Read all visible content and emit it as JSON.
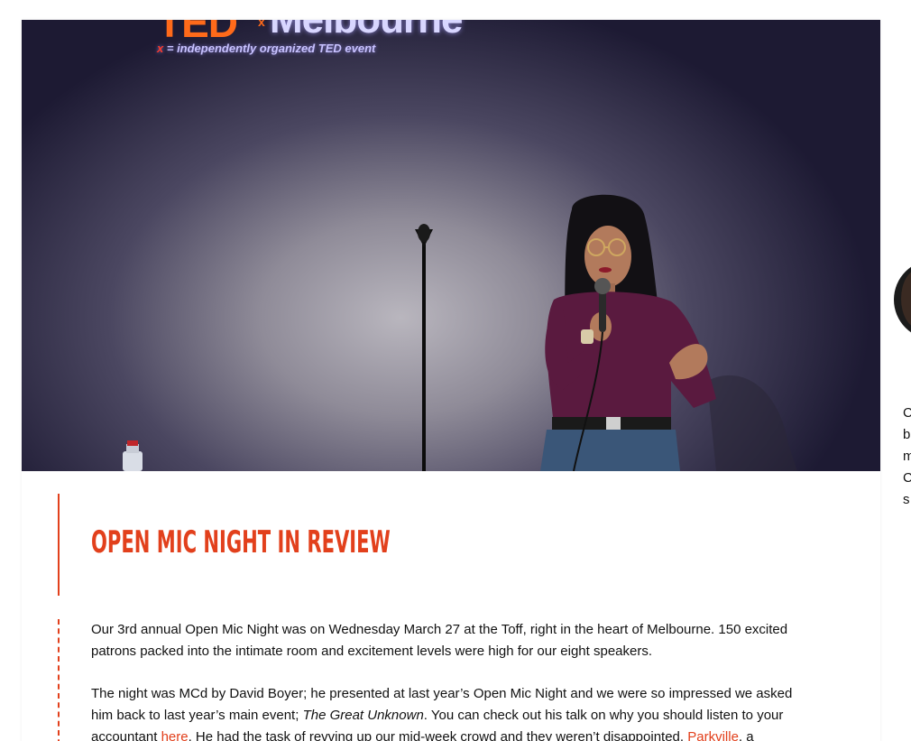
{
  "hero": {
    "logo": {
      "brand": "TED",
      "superscript": "x",
      "city": "Melbourne",
      "tagline_prefix": "x",
      "tagline": "= independently organized TED event"
    }
  },
  "article": {
    "title": "Open Mic Night in Review",
    "paragraph1": "Our 3rd annual Open Mic Night was on Wednesday March 27 at the Toff, right in the heart of Melbourne. 150 excited patrons packed into the intimate room and excitement levels were high for our eight speakers.",
    "paragraph2": {
      "part1": "The night was MCd by David Boyer; he presented at last year’s Open Mic Night and we were so impressed we asked him back to last year’s main event; ",
      "event_name": "The Great Unknown",
      "part2": ". You can check out his talk on why you should listen to your accountant ",
      "link_here": "here",
      "part3": ". He had the task of revving up our mid-week crowd and they weren’t disappointed. ",
      "link_parkville": "Parkville",
      "part4": ", a"
    }
  },
  "sidebar": {
    "bio_lines": [
      "C",
      "b",
      "m",
      "C",
      "s"
    ]
  },
  "colors": {
    "accent": "#e2401c",
    "text": "#111111"
  }
}
